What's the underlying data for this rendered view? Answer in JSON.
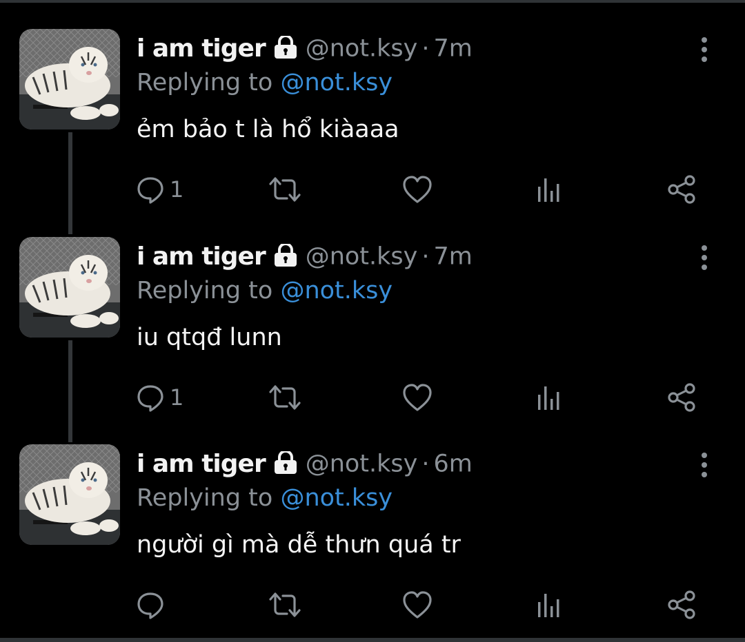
{
  "tweets": [
    {
      "name": "i am tiger",
      "handle": "@not.ksy",
      "separator": "·",
      "time": "7m",
      "replying_prefix": "Replying to ",
      "replying_to": "@not.ksy",
      "text": "ẻm bảo t là hổ kiàaaa",
      "reply_count": "1",
      "avatar": "white-tiger-photo"
    },
    {
      "name": "i am tiger",
      "handle": "@not.ksy",
      "separator": "·",
      "time": "7m",
      "replying_prefix": "Replying to ",
      "replying_to": "@not.ksy",
      "text": "iu qtqđ lunn",
      "reply_count": "1",
      "avatar": "white-tiger-photo"
    },
    {
      "name": "i am tiger",
      "handle": "@not.ksy",
      "separator": "·",
      "time": "6m",
      "replying_prefix": "Replying to ",
      "replying_to": "@not.ksy",
      "text": "người gì mà dễ thưn quá tr",
      "reply_count": "",
      "avatar": "white-tiger-photo"
    }
  ],
  "icons": {
    "lock": "lock-icon",
    "more": "more-vertical-icon",
    "reply": "reply-icon",
    "retweet": "retweet-icon",
    "like": "heart-icon",
    "views": "analytics-icon",
    "share": "share-icon"
  },
  "colors": {
    "background": "#000000",
    "text": "#e7e9ea",
    "secondary": "#8b9197",
    "mention": "#3a8fd9",
    "thread_line": "#333639"
  }
}
